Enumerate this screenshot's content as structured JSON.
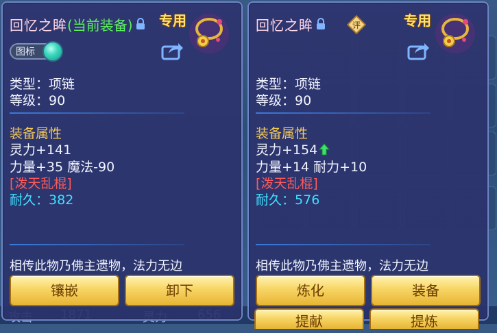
{
  "background": {
    "bottom_stats": [
      {
        "label": "攻击",
        "value": "1871"
      },
      {
        "label": "灵力",
        "value": "656"
      }
    ]
  },
  "left_panel": {
    "name": "回忆之眸",
    "equipped_tag": "(当前装备)",
    "exclusive": "专用",
    "toggle_label": "图标",
    "type_line": "类型：项链",
    "level_line": "等级：90",
    "section_title": "装备属性",
    "stat1": "灵力+141",
    "stat2": "力量+35 魔法-90",
    "special": "[泼天乱棍]",
    "durability_label": "耐久：",
    "durability_value": "382",
    "description": "相传此物乃佛主遗物，法力无边",
    "buttons": [
      "镶嵌",
      "卸下"
    ]
  },
  "right_panel": {
    "name": "回忆之眸",
    "eval_icon_text": "评",
    "exclusive": "专用",
    "type_line": "类型：项链",
    "level_line": "等级：90",
    "section_title": "装备属性",
    "stat1": "灵力+154",
    "stat2": "力量+14 耐力+10",
    "special": "[泼天乱棍]",
    "durability_label": "耐久：",
    "durability_value": "576",
    "description": "相传此物乃佛主遗物，法力无边",
    "buttons": [
      "炼化",
      "装备"
    ],
    "buttons_partial": [
      "提献",
      "提炼"
    ]
  },
  "icons": {
    "lock": "lock-icon",
    "share": "share-icon",
    "necklace": "necklace-icon",
    "up_arrow": "up-arrow-icon",
    "eval": "evaluate-icon"
  },
  "colors": {
    "panel_bg": "#2e346e",
    "name": "#ffd6e6",
    "equipped": "#5cf05c",
    "exclusive": "#ffe36a",
    "section": "#f1c85a",
    "special": "#ff5a5a",
    "durability": "#3fe0ff",
    "button": "#f7d565"
  }
}
